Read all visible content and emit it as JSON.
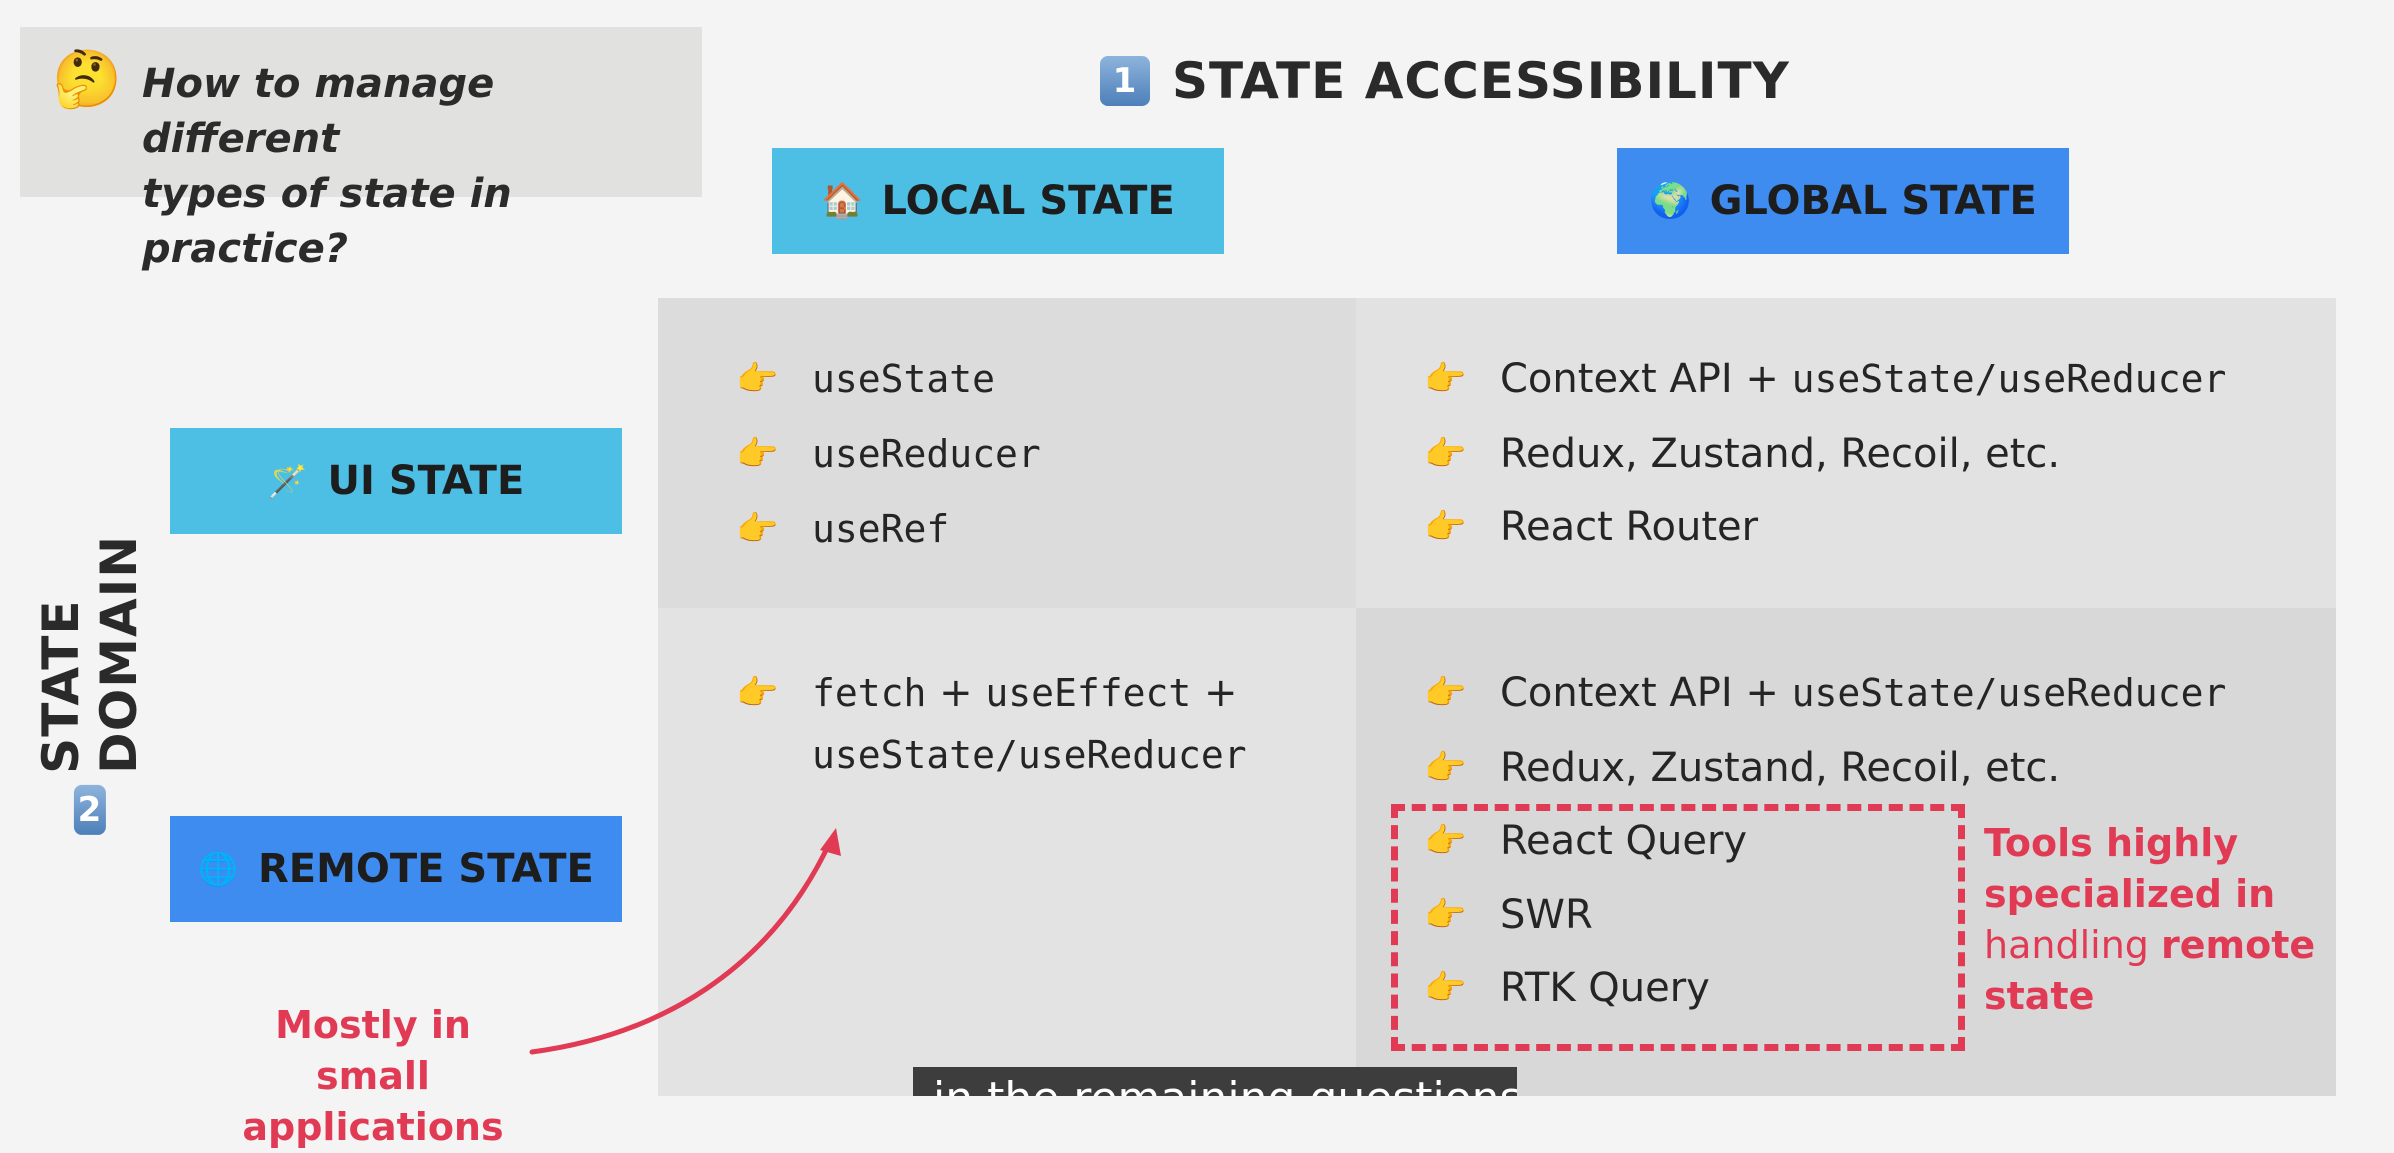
{
  "question": {
    "emoji": "🤔",
    "text_line1": "How to manage different",
    "text_line2": "types of state in practice?"
  },
  "header": {
    "number": "1",
    "title": "STATE ACCESSIBILITY"
  },
  "columns": {
    "local": {
      "emoji": "🏠",
      "label": "LOCAL STATE"
    },
    "global": {
      "emoji": "🌍",
      "label": "GLOBAL STATE"
    }
  },
  "side": {
    "number": "2",
    "label": "STATE DOMAIN"
  },
  "rows": {
    "ui": {
      "emoji": "🪄",
      "label": "UI STATE"
    },
    "remote": {
      "emoji": "🌐",
      "label": "REMOTE STATE"
    }
  },
  "cells": {
    "ui_local": [
      "useState",
      "useReducer",
      "useRef"
    ],
    "ui_global": {
      "item1_text": "Context API + ",
      "item1_code": "useState/useReducer",
      "item2": "Redux, Zustand, Recoil, etc.",
      "item3": "React Router"
    },
    "remote_local": {
      "line1_code_a": "fetch",
      "line1_plus1": " + ",
      "line1_code_b": "useEffect",
      "line1_plus2": " +",
      "line2_code": "useState/useReducer"
    },
    "remote_global": {
      "item1_text": "Context API + ",
      "item1_code": "useState/useReducer",
      "item2": "Redux, Zustand, Recoil, etc.",
      "item3": "React Query",
      "item4": "SWR",
      "item5": "RTK Query"
    }
  },
  "notes": {
    "tools_line1": "Tools highly",
    "tools_line2": "specialized in",
    "tools_line3_a": "handling ",
    "tools_line3_b": "remote",
    "tools_line4": "state",
    "small_line1": "Mostly in small",
    "small_line2": "applications"
  },
  "caption": {
    "text": "in the remaining questions"
  },
  "colors": {
    "cyan": "#4dbfe4",
    "blue": "#3f8cf0",
    "accent_red": "#e03a54"
  },
  "icons": {
    "pointer": "👉"
  }
}
